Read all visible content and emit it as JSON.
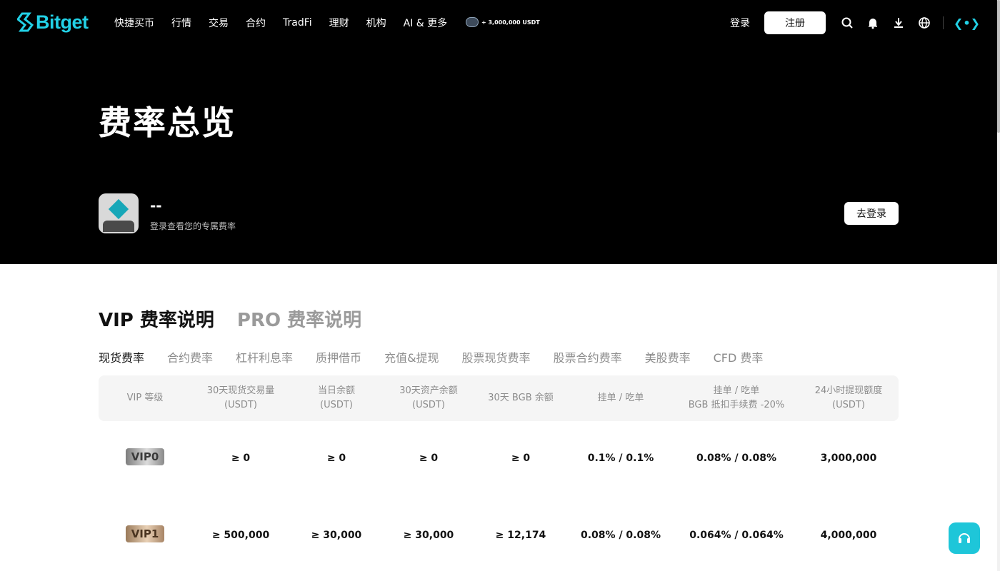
{
  "header": {
    "logo_text": "Bitget",
    "nav": [
      "快捷买币",
      "行情",
      "交易",
      "合约",
      "TradFi",
      "理财",
      "机构",
      "AI & 更多"
    ],
    "promo_text": "+ 3,000,000 USDT",
    "login_label": "登录",
    "register_label": "注册",
    "brand_mark": "❮•❯"
  },
  "hero": {
    "title": "费率总览",
    "user_name": "--",
    "user_subtitle": "登录查看您的专属费率",
    "login_button": "去登录"
  },
  "section_tabs": [
    "VIP 费率说明",
    "PRO 费率说明"
  ],
  "sub_tabs": [
    "现货费率",
    "合约费率",
    "杠杆利息率",
    "质押借币",
    "充值&提现",
    "股票现货费率",
    "股票合约费率",
    "美股费率",
    "CFD 费率"
  ],
  "table": {
    "headers": [
      [
        "VIP 等级"
      ],
      [
        "30天现货交易量",
        "(USDT)"
      ],
      [
        "当日余额",
        "(USDT)"
      ],
      [
        "30天资产余额",
        "(USDT)"
      ],
      [
        "30天 BGB 余额"
      ],
      [
        "挂单 / 吃单"
      ],
      [
        "挂单 / 吃单",
        "BGB 抵扣手续费 -20%"
      ],
      [
        "24小时提现额度",
        "(USDT)"
      ]
    ],
    "rows": [
      [
        "VIP0",
        "≥ 0",
        "≥ 0",
        "≥ 0",
        "≥ 0",
        "0.1% / 0.1%",
        "0.08% / 0.08%",
        "3,000,000"
      ],
      [
        "VIP1",
        "≥ 500,000",
        "≥ 30,000",
        "≥ 30,000",
        "≥ 12,174",
        "0.08% / 0.08%",
        "0.064% / 0.064%",
        "4,000,000"
      ]
    ]
  },
  "colors": {
    "brand": "#1ec6d9",
    "header_bg": "#000000"
  }
}
